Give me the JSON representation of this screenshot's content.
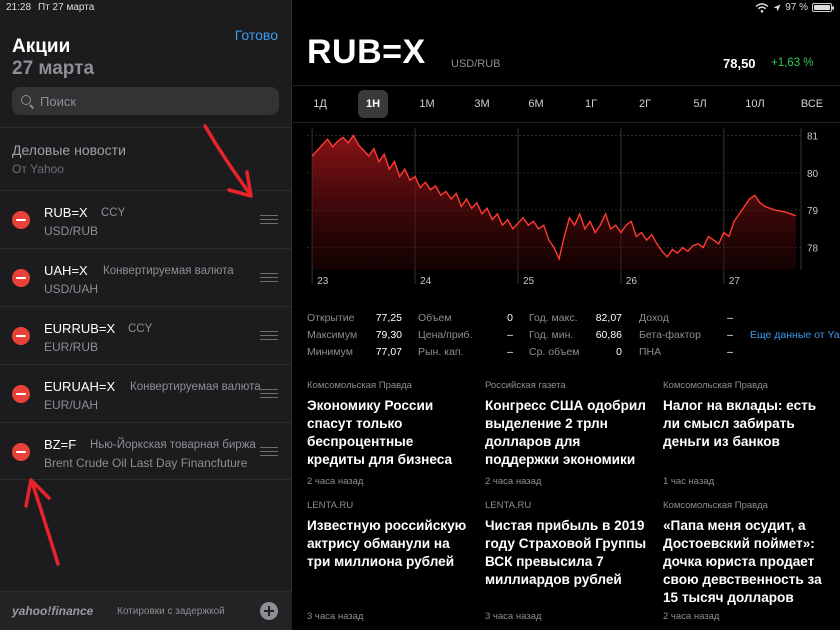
{
  "status": {
    "time": "21:28",
    "date": "Пт 27 марта",
    "battery": "97 %",
    "battery_level": 0.97
  },
  "sidebar": {
    "done": "Готово",
    "title": "Акции",
    "date": "27 марта",
    "search_placeholder": "Поиск",
    "news_title": "Деловые новости",
    "news_source": "От Yahoo",
    "items": [
      {
        "symbol": "RUB=X",
        "type": "CCY",
        "name": "USD/RUB"
      },
      {
        "symbol": "UAH=X",
        "type": "Конвертируемая валюта",
        "name": "USD/UAH"
      },
      {
        "symbol": "EURRUB=X",
        "type": "CCY",
        "name": "EUR/RUB"
      },
      {
        "symbol": "EURUAH=X",
        "type": "Конвертируемая валюта",
        "name": "EUR/UAH"
      },
      {
        "symbol": "BZ=F",
        "type": "Нью-Йоркская товарная биржа",
        "name": "Brent Crude Oil Last Day Financfuture"
      }
    ],
    "footer_logo": "yahoo!finance",
    "footer_note": "Котировки с задержкой"
  },
  "main": {
    "ticker": "RUB=X",
    "pair": "USD/RUB",
    "price": "78,50",
    "change": "+1,63 %",
    "colors": {
      "up": "#34c759",
      "line": "#ff3b30",
      "link": "#3a9bf0"
    },
    "ranges": [
      "1Д",
      "1Н",
      "1М",
      "3М",
      "6М",
      "1Г",
      "2Г",
      "5Л",
      "10Л",
      "ВСЕ"
    ],
    "active_range": "1Н",
    "stats": {
      "col1": [
        {
          "label": "Открытие",
          "value": "77,25"
        },
        {
          "label": "Максимум",
          "value": "79,30"
        },
        {
          "label": "Минимум",
          "value": "77,07"
        }
      ],
      "col2": [
        {
          "label": "Объем",
          "value": "0"
        },
        {
          "label": "Цена/приб.",
          "value": "–"
        },
        {
          "label": "Рын. кап.",
          "value": "–"
        }
      ],
      "col3": [
        {
          "label": "Год. макс.",
          "value": "82,07"
        },
        {
          "label": "Год. мин.",
          "value": "60,86"
        },
        {
          "label": "Ср. объем",
          "value": "0"
        }
      ],
      "col4": [
        {
          "label": "Доход",
          "value": "–"
        },
        {
          "label": "Бета-фактор",
          "value": "–"
        },
        {
          "label": "ПНА",
          "value": "–"
        }
      ],
      "more": "Еще данные от Yahoo"
    },
    "news": [
      {
        "source": "Комсомольская Правда",
        "headline": "Экономику России спасут только беспроцентные кредиты для бизнеса",
        "age": "2 часа назад"
      },
      {
        "source": "Российская газета",
        "headline": "Конгресс США одобрил выделение 2 трлн долларов для поддержки экономики",
        "age": "2 часа назад"
      },
      {
        "source": "Комсомольская Правда",
        "headline": "Налог на вклады: есть ли смысл забирать деньги из банков",
        "age": "1 час назад"
      },
      {
        "source": "LENTA.RU",
        "headline": "Известную российскую актрису обманули на три миллиона рублей",
        "age": "3 часа назад"
      },
      {
        "source": "LENTA.RU",
        "headline": "Чистая прибыль в 2019 году Страховой Группы ВСК превысила 7 миллиардов рублей",
        "age": "3 часа назад"
      },
      {
        "source": "Комсомольская Правда",
        "headline": "«Папа меня осудит, а Достоевский поймет»: дочка юриста продает свою девственность за 15 тысяч долларов",
        "age": "2 часа назад"
      }
    ]
  },
  "chart_data": {
    "type": "area",
    "title": "",
    "xlabel": "",
    "ylabel": "",
    "x_ticks": [
      "23",
      "24",
      "25",
      "26",
      "27"
    ],
    "y_ticks": [
      81,
      80,
      79,
      78
    ],
    "ylim": [
      77.4,
      81.2
    ],
    "grid": true,
    "series": [
      {
        "x": [
          0,
          0.05,
          0.1,
          0.15,
          0.2,
          0.25,
          0.3,
          0.35,
          0.4,
          0.45,
          0.5,
          0.55,
          0.6,
          0.65,
          0.7,
          0.75,
          0.8,
          0.85,
          0.9,
          0.95,
          1.0,
          1.05,
          1.1,
          1.15,
          1.2,
          1.25,
          1.3,
          1.35,
          1.4,
          1.45,
          1.5,
          1.55,
          1.6,
          1.65,
          1.7,
          1.75,
          1.8,
          1.85,
          1.9,
          1.95,
          2.0,
          2.05,
          2.1,
          2.15,
          2.2,
          2.25,
          2.3,
          2.35,
          2.4,
          2.45,
          2.5,
          2.55,
          2.6,
          2.65,
          2.7,
          2.75,
          2.8,
          2.85,
          2.9,
          2.95,
          3.0,
          3.05,
          3.1,
          3.15,
          3.2,
          3.25,
          3.3,
          3.35,
          3.4,
          3.45,
          3.5,
          3.55,
          3.6,
          3.65,
          3.7,
          3.75,
          3.8,
          3.85,
          3.9,
          3.95,
          4.0,
          4.05,
          4.1,
          4.15,
          4.2,
          4.25,
          4.3,
          4.35,
          4.4,
          4.5,
          4.6,
          4.7
        ],
        "values": [
          80.45,
          80.6,
          80.75,
          80.9,
          80.7,
          80.85,
          80.95,
          80.8,
          81.0,
          80.75,
          80.6,
          80.45,
          80.65,
          80.3,
          80.5,
          80.1,
          80.3,
          79.9,
          80.1,
          79.8,
          79.9,
          79.6,
          79.75,
          79.55,
          79.65,
          79.4,
          79.5,
          79.3,
          79.45,
          79.1,
          79.3,
          79.05,
          79.2,
          78.9,
          79.05,
          78.75,
          78.9,
          78.6,
          78.75,
          78.5,
          78.65,
          78.8,
          78.6,
          78.7,
          78.5,
          78.6,
          78.2,
          78.0,
          77.7,
          78.3,
          78.8,
          78.6,
          78.9,
          78.5,
          78.7,
          78.4,
          78.6,
          78.9,
          78.5,
          78.6,
          78.4,
          78.6,
          78.7,
          78.3,
          78.4,
          78.2,
          78.35,
          78.1,
          77.9,
          77.75,
          77.95,
          77.85,
          78.0,
          77.9,
          78.05,
          78.1,
          78.0,
          78.3,
          78.2,
          78.1,
          78.4,
          78.3,
          78.7,
          78.9,
          79.1,
          79.3,
          79.4,
          79.2,
          79.1,
          79.0,
          78.95,
          78.85
        ]
      }
    ]
  }
}
